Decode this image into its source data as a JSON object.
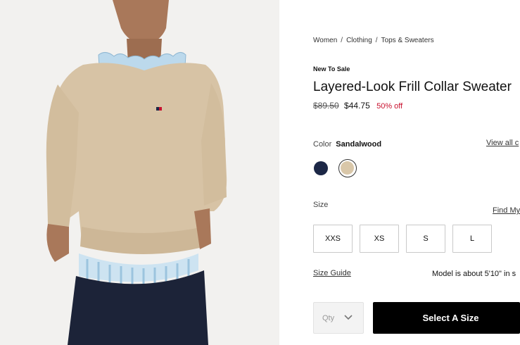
{
  "breadcrumb": [
    "Women",
    "Clothing",
    "Tops & Sweaters"
  ],
  "badge": "New To Sale",
  "title": "Layered-Look Frill Collar Sweater",
  "price": {
    "original": "$89.50",
    "sale": "$44.75",
    "discount": "50% off"
  },
  "color": {
    "label": "Color",
    "selected": "Sandalwood",
    "view_all": "View all c",
    "swatches": [
      {
        "name": "navy",
        "hex": "#1c2746"
      },
      {
        "name": "sandalwood",
        "hex": "#d9c7a9",
        "selected": true
      }
    ]
  },
  "size": {
    "label": "Size",
    "find_my": "Find My",
    "options": [
      "XXS",
      "XS",
      "S",
      "L"
    ],
    "guide": "Size Guide",
    "model_info": "Model is about 5'10\" in s"
  },
  "qty_placeholder": "Qty",
  "cta": "Select A Size",
  "colors": {
    "accent": "#000000",
    "discount": "#c8102e",
    "photo_bg": "#f2f1ef"
  }
}
